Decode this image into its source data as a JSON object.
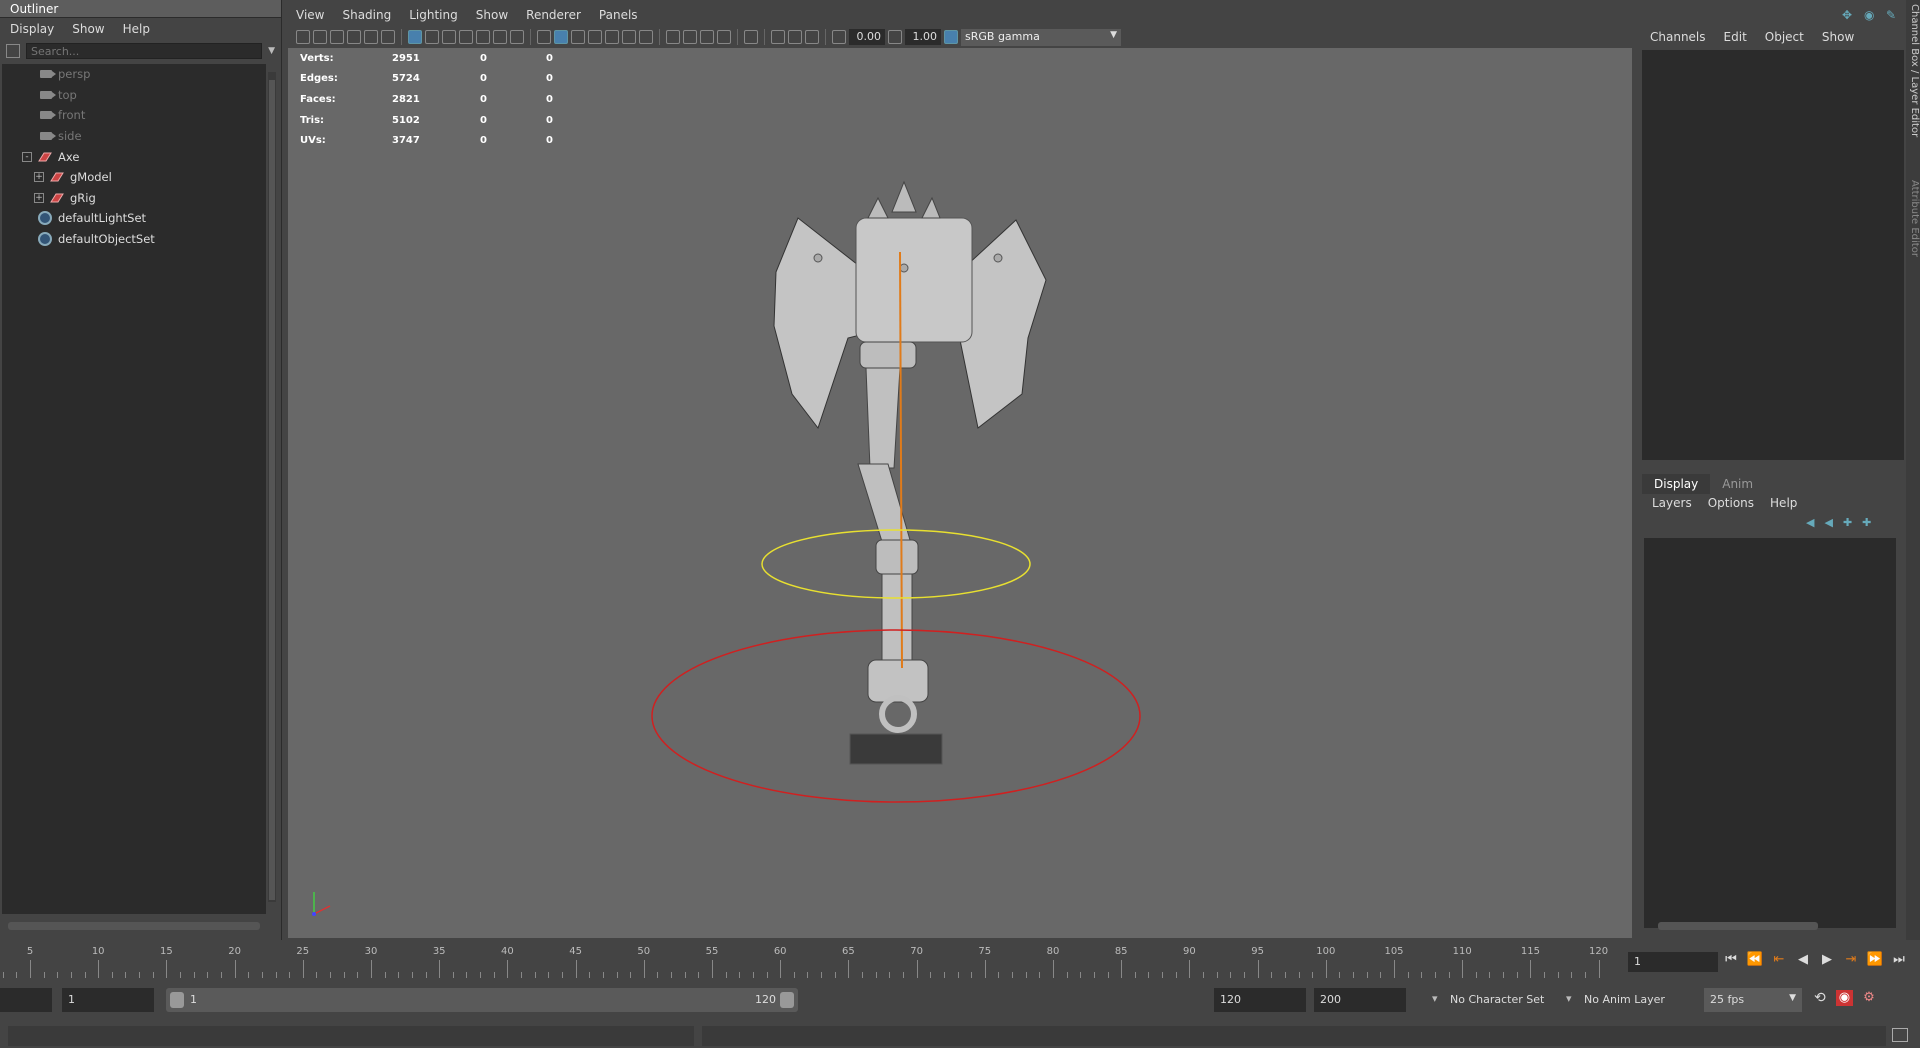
{
  "outliner": {
    "title": "Outliner",
    "menu": [
      "Display",
      "Show",
      "Help"
    ],
    "search_placeholder": "Search...",
    "items": [
      {
        "label": "persp",
        "type": "camera",
        "dim": true
      },
      {
        "label": "top",
        "type": "camera",
        "dim": true
      },
      {
        "label": "front",
        "type": "camera",
        "dim": true
      },
      {
        "label": "side",
        "type": "camera",
        "dim": true
      },
      {
        "label": "Axe",
        "type": "group",
        "expander": "-"
      },
      {
        "label": "gModel",
        "type": "group",
        "expander": "+"
      },
      {
        "label": "gRig",
        "type": "group",
        "expander": "+"
      },
      {
        "label": "defaultLightSet",
        "type": "set"
      },
      {
        "label": "defaultObjectSet",
        "type": "set"
      }
    ]
  },
  "viewport": {
    "menu": [
      "View",
      "Shading",
      "Lighting",
      "Show",
      "Renderer",
      "Panels"
    ],
    "toolbar": {
      "exposure": "0.00",
      "gamma": "1.00",
      "color_space": "sRGB gamma"
    },
    "hud": [
      {
        "label": "Verts:",
        "value": "2951",
        "a": "0",
        "b": "0"
      },
      {
        "label": "Edges:",
        "value": "5724",
        "a": "0",
        "b": "0"
      },
      {
        "label": "Faces:",
        "value": "2821",
        "a": "0",
        "b": "0"
      },
      {
        "label": "Tris:",
        "value": "5102",
        "a": "0",
        "b": "0"
      },
      {
        "label": "UVs:",
        "value": "3747",
        "a": "0",
        "b": "0"
      }
    ],
    "colors": {
      "mesh": "#c2c2c2",
      "joint": "#e07b1a",
      "control_inner": "#e8e030",
      "control_outer": "#d02020"
    }
  },
  "right_panel": {
    "channels_menu": [
      "Channels",
      "Edit",
      "Object",
      "Show"
    ],
    "tabs": [
      "Display",
      "Anim"
    ],
    "active_tab": "Display",
    "layers_menu": [
      "Layers",
      "Options",
      "Help"
    ],
    "side_tabs": [
      "Channel Box / Layer Editor",
      "Attribute Editor"
    ]
  },
  "time_slider": {
    "ticks": [
      "5",
      "10",
      "15",
      "20",
      "25",
      "30",
      "35",
      "40",
      "45",
      "50",
      "55",
      "60",
      "65",
      "70",
      "75",
      "80",
      "85",
      "90",
      "95",
      "100",
      "105",
      "110",
      "115",
      "120"
    ],
    "current_frame": "1",
    "playback_buttons": [
      "go-to-start",
      "step-back-key",
      "step-back-frame",
      "play-backward",
      "play-forward",
      "step-forward-frame",
      "step-forward-key",
      "go-to-end"
    ]
  },
  "range_slider": {
    "start_time": "1",
    "range_start": "1",
    "range_end": "120",
    "end_time": "120",
    "max_time": "200",
    "character_set": "No Character Set",
    "anim_layer": "No Anim Layer",
    "fps": "25 fps"
  }
}
